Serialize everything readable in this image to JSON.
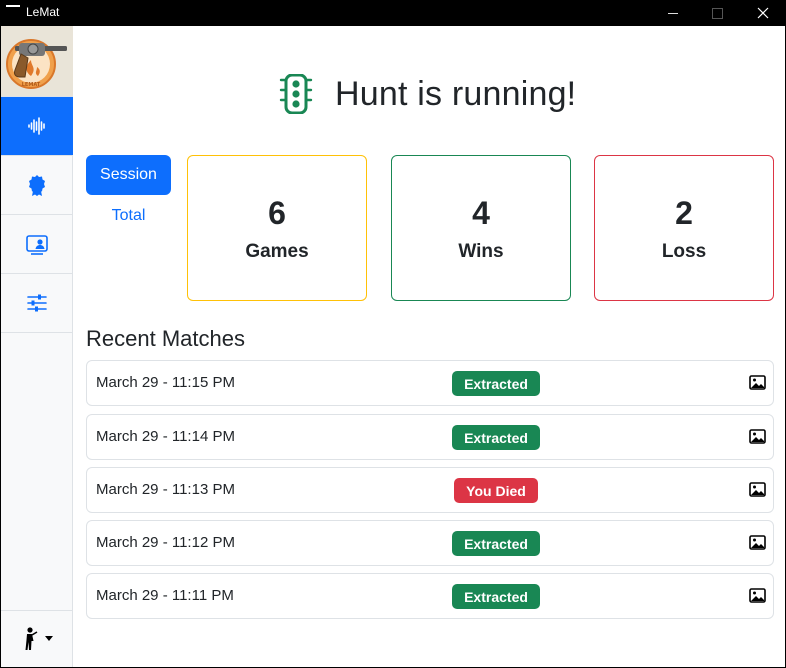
{
  "window": {
    "title": "LeMat"
  },
  "sidebar": {
    "items": [
      {
        "name": "activity",
        "icon": "soundwave-icon",
        "active": true
      },
      {
        "name": "awards",
        "icon": "award-icon",
        "active": false
      },
      {
        "name": "screenshots",
        "icon": "person-video-icon",
        "active": false
      },
      {
        "name": "settings",
        "icon": "sliders-icon",
        "active": false
      }
    ],
    "user_icon": "person-walking-icon",
    "user_dropdown_icon": "caret-down-icon"
  },
  "status": {
    "text": "Hunt is running!",
    "icon": "traffic-light-icon",
    "color": "#198754"
  },
  "period": {
    "session_label": "Session",
    "total_label": "Total",
    "selected": "Session"
  },
  "stats": {
    "games": {
      "value": "6",
      "label": "Games",
      "color": "#ffc107"
    },
    "wins": {
      "value": "4",
      "label": "Wins",
      "color": "#198754"
    },
    "loss": {
      "value": "2",
      "label": "Loss",
      "color": "#dc3545"
    }
  },
  "recent": {
    "title": "Recent Matches",
    "matches": [
      {
        "date": "March 29 - 11:15 PM",
        "result": "Extracted",
        "status": "success"
      },
      {
        "date": "March 29 - 11:14 PM",
        "result": "Extracted",
        "status": "success"
      },
      {
        "date": "March 29 - 11:13 PM",
        "result": "You Died",
        "status": "danger"
      },
      {
        "date": "March 29 - 11:12 PM",
        "result": "Extracted",
        "status": "success"
      },
      {
        "date": "March 29 - 11:11 PM",
        "result": "Extracted",
        "status": "success"
      }
    ]
  }
}
